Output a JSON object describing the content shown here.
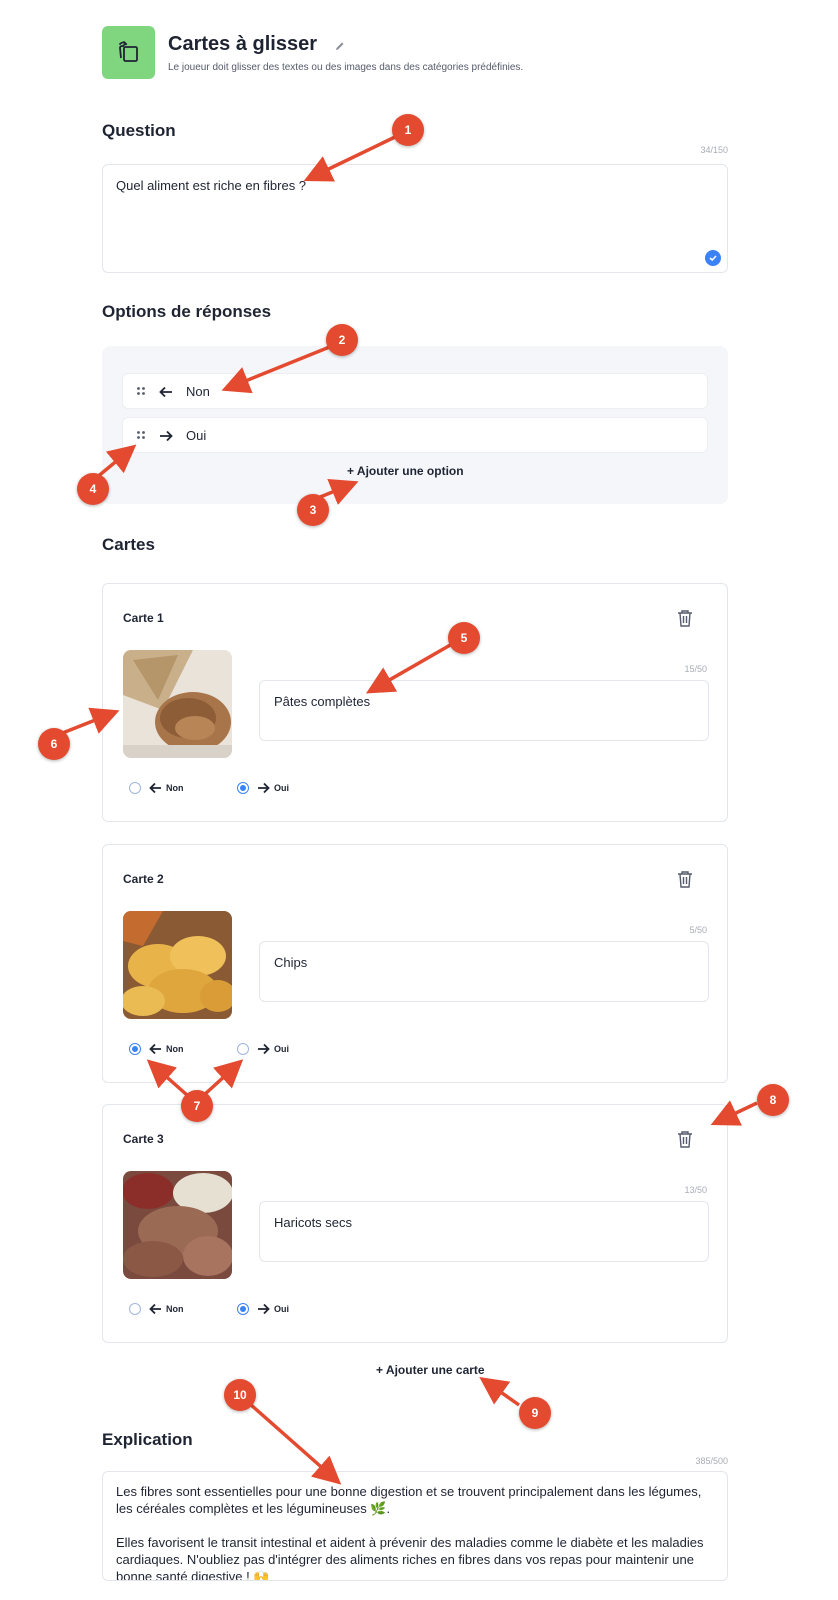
{
  "header": {
    "title": "Cartes à glisser",
    "subtitle": "Le joueur doit glisser des textes ou des images dans des catégories prédéfinies."
  },
  "question": {
    "heading": "Question",
    "counter": "34/150",
    "value": "Quel aliment est riche en fibres ?"
  },
  "options": {
    "heading": "Options de réponses",
    "items": [
      {
        "label": "Non",
        "direction": "left"
      },
      {
        "label": "Oui",
        "direction": "right"
      }
    ],
    "add_label": "Ajouter une option"
  },
  "cards": {
    "heading": "Cartes",
    "items": [
      {
        "title": "Carte 1",
        "counter": "15/50",
        "text": "Pâtes complètes",
        "image": "pasta-photo",
        "selected": "Oui"
      },
      {
        "title": "Carte 2",
        "counter": "5/50",
        "text": "Chips",
        "image": "chips-photo",
        "selected": "Non"
      },
      {
        "title": "Carte 3",
        "counter": "13/50",
        "text": "Haricots secs",
        "image": "beans-photo",
        "selected": "Oui"
      }
    ],
    "radio_labels": {
      "non": "Non",
      "oui": "Oui"
    },
    "add_label": "Ajouter une carte"
  },
  "explanation": {
    "heading": "Explication",
    "counter": "385/500",
    "paragraph1": "Les fibres sont essentielles pour une bonne digestion et se trouvent principalement dans les légumes, les céréales complètes et les légumineuses 🌿.",
    "paragraph2": "Elles favorisent le transit intestinal et aident à prévenir des maladies comme le diabète et les maladies cardiaques. N'oubliez pas d'intégrer des aliments riches en fibres dans vos repas pour maintenir une bonne santé digestive ! 🙌"
  },
  "markers": [
    "1",
    "2",
    "3",
    "4",
    "5",
    "6",
    "7",
    "8",
    "9",
    "10"
  ],
  "colors": {
    "accent": "#3b82f6",
    "marker": "#e44a2f",
    "header_icon_bg": "#7fd67f",
    "panel_bg": "#f4f6f9"
  }
}
